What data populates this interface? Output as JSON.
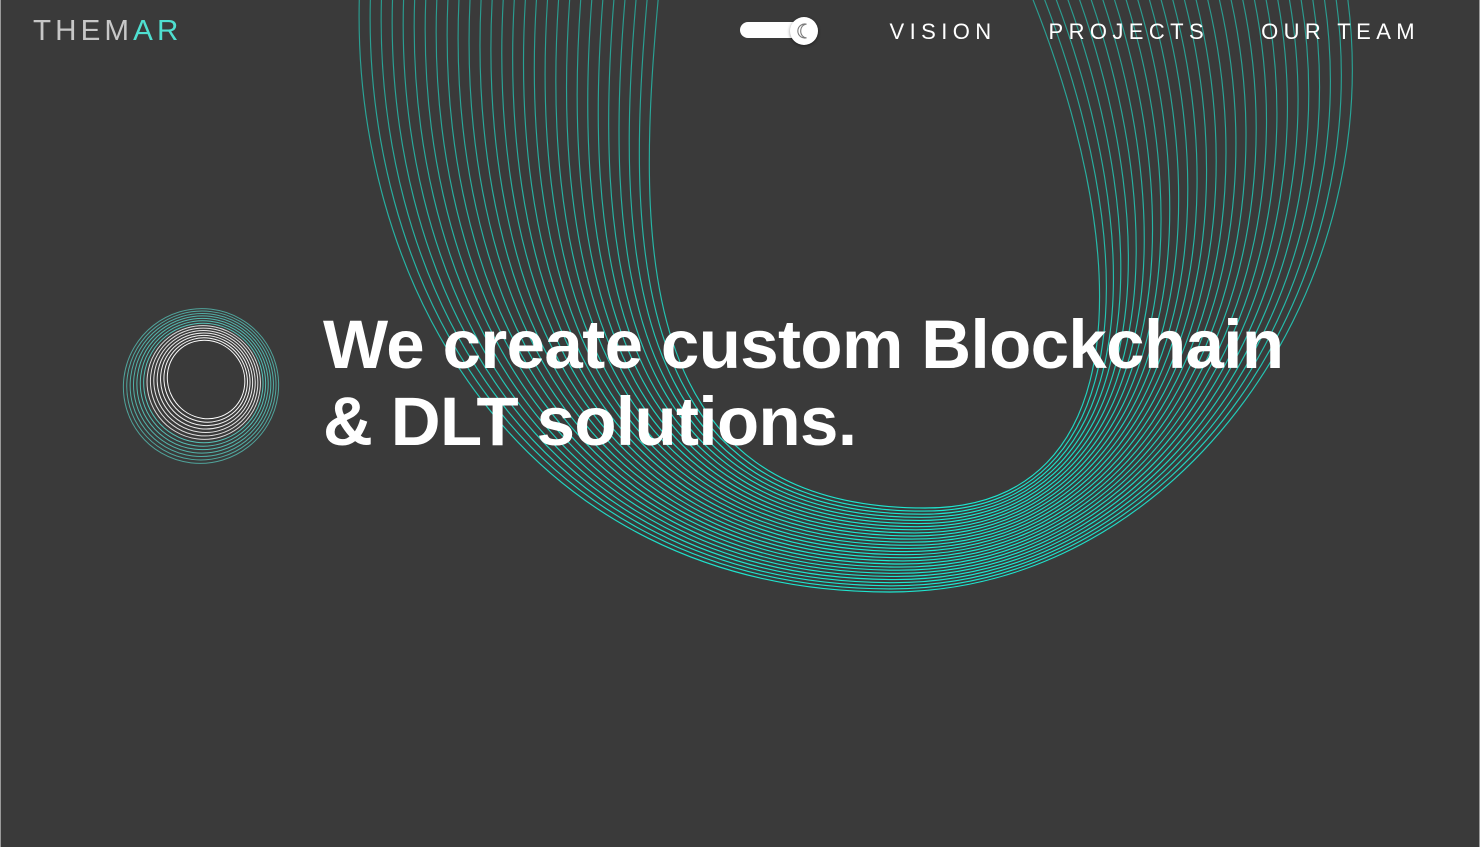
{
  "brand": {
    "part1": "THEM",
    "part2": "AR",
    "accent_color": "#4fdfd0",
    "text_color": "#c7c7c7"
  },
  "theme_toggle": {
    "icon": "moon-icon",
    "state": "dark"
  },
  "nav": {
    "items": [
      {
        "label": "VISION"
      },
      {
        "label": "PROJECTS"
      },
      {
        "label": "OUR TEAM"
      }
    ]
  },
  "hero": {
    "logo_icon": "ring-logo-icon",
    "headline_line1": "We create custom Blockchain",
    "headline_line2": "& DLT solutions."
  },
  "colors": {
    "background": "#3a3a3a",
    "accent": "#1ee6d0",
    "text": "#ffffff"
  }
}
